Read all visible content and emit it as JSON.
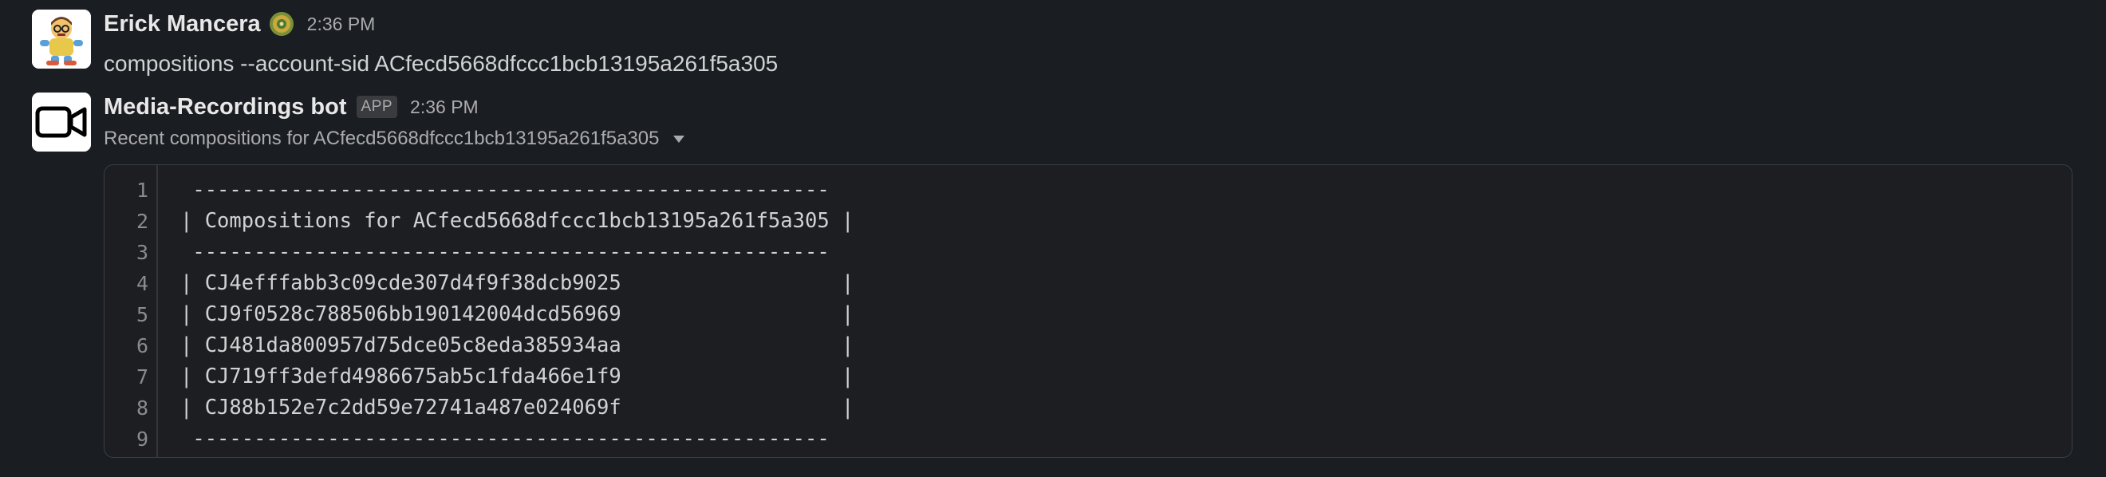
{
  "messages": [
    {
      "sender": "Erick Mancera",
      "status_emoji": "badge-emoji-icon",
      "time": "2:36 PM",
      "text": "compositions --account-sid ACfecd5668dfccc1bcb13195a261f5a305",
      "avatar": "cartoon-character-avatar"
    },
    {
      "sender": "Media-Recordings bot",
      "badge": "APP",
      "time": "2:36 PM",
      "avatar": "video-camera-icon",
      "attachment_title": "Recent compositions for ACfecd5668dfccc1bcb13195a261f5a305"
    }
  ],
  "code": {
    "line_numbers": [
      "1",
      "2",
      "3",
      "4",
      "5",
      "6",
      "7",
      "8",
      "9"
    ],
    "lines": [
      " ----------------------------------------------------",
      "| Compositions for ACfecd5668dfccc1bcb13195a261f5a305 |",
      " ----------------------------------------------------",
      "| CJ4efffabb3c09cde307d4f9f38dcb9025                  |",
      "| CJ9f0528c788506bb190142004dcd56969                  |",
      "| CJ481da800957d75dce05c8eda385934aa                  |",
      "| CJ719ff3defd4986675ab5c1fda466e1f9                  |",
      "| CJ88b152e7c2dd59e72741a487e024069f                  |",
      " ----------------------------------------------------"
    ]
  },
  "colors": {
    "background": "#1a1d21",
    "text": "#d1d2d3",
    "muted": "#ababad"
  }
}
